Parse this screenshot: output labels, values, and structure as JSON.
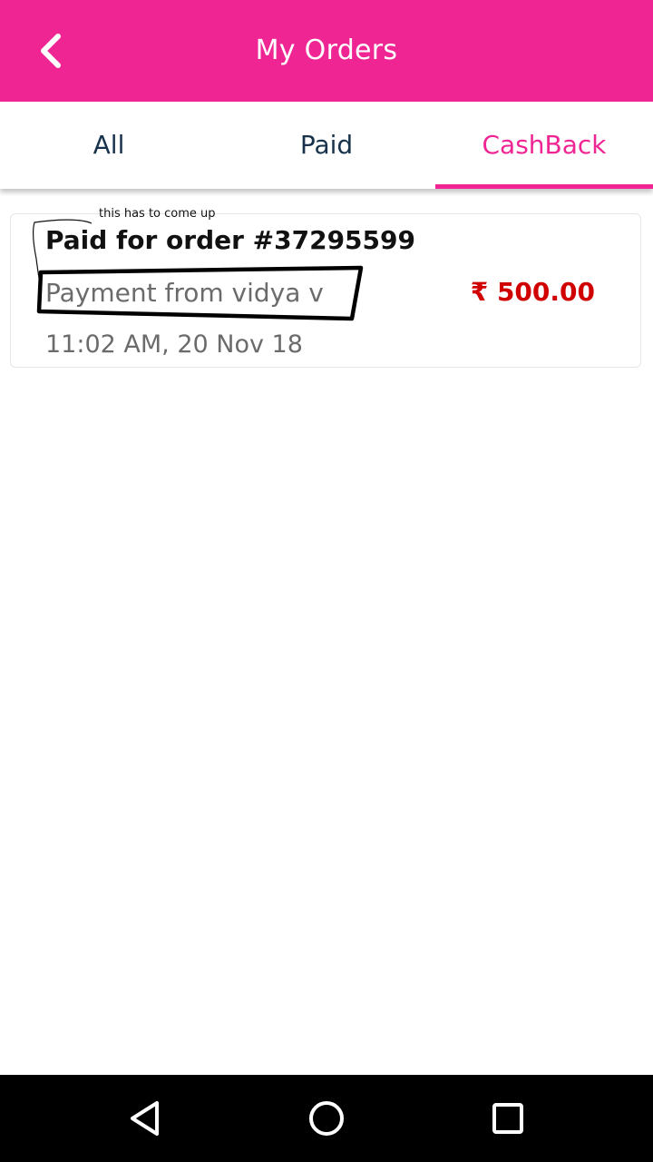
{
  "appbar": {
    "title": "My Orders",
    "back_icon": "chevron-left-icon"
  },
  "tabs": [
    {
      "label": "All",
      "active": false
    },
    {
      "label": "Paid",
      "active": false
    },
    {
      "label": "CashBack",
      "active": true
    }
  ],
  "orders": [
    {
      "title": "Paid for order #37295599",
      "subtitle": "Payment from vidya v",
      "timestamp": "11:02 AM, 20 Nov 18",
      "amount": "₹ 500.00"
    }
  ],
  "annotation": {
    "note": "this has to come up"
  },
  "navbar": {
    "back": "triangle-back-icon",
    "home": "circle-home-icon",
    "recents": "square-recents-icon"
  },
  "colors": {
    "accent": "#ef2594",
    "amount": "#d10000",
    "text_dark": "#17324a"
  }
}
